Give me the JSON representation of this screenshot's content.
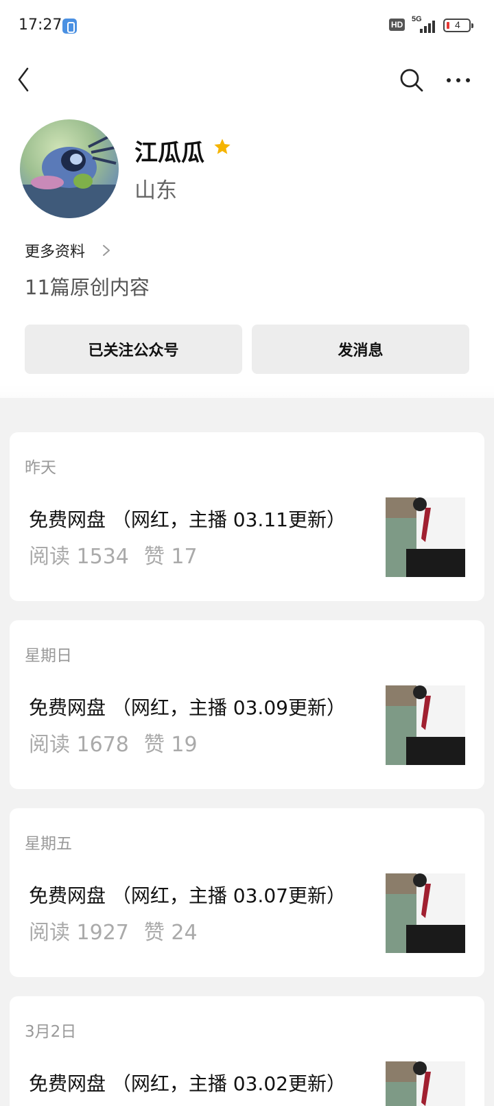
{
  "status_bar": {
    "time": "17:27",
    "hd": "HD",
    "network": "5G",
    "battery": "4"
  },
  "nav": {
    "back_icon": "chevron-left-icon",
    "search_icon": "search-icon",
    "more_icon": "more-icon"
  },
  "profile": {
    "name": "江瓜瓜",
    "region": "山东",
    "more_info_label": "更多资料",
    "article_count": "11篇原创内容",
    "star_color": "#f5b400"
  },
  "actions": {
    "follow_label": "已关注公众号",
    "message_label": "发消息"
  },
  "articles": [
    {
      "date": "昨天",
      "title": "免费网盘 （网红，主播 03.11更新）",
      "reads": "阅读 1534",
      "likes": "赞 17"
    },
    {
      "date": "星期日",
      "title": "免费网盘 （网红，主播 03.09更新）",
      "reads": "阅读 1678",
      "likes": "赞 19"
    },
    {
      "date": "星期五",
      "title": "免费网盘 （网红，主播 03.07更新）",
      "reads": "阅读 1927",
      "likes": "赞 24"
    },
    {
      "date": "3月2日",
      "title": "免费网盘 （网红，主播 03.02更新）",
      "reads": "",
      "likes": ""
    }
  ]
}
